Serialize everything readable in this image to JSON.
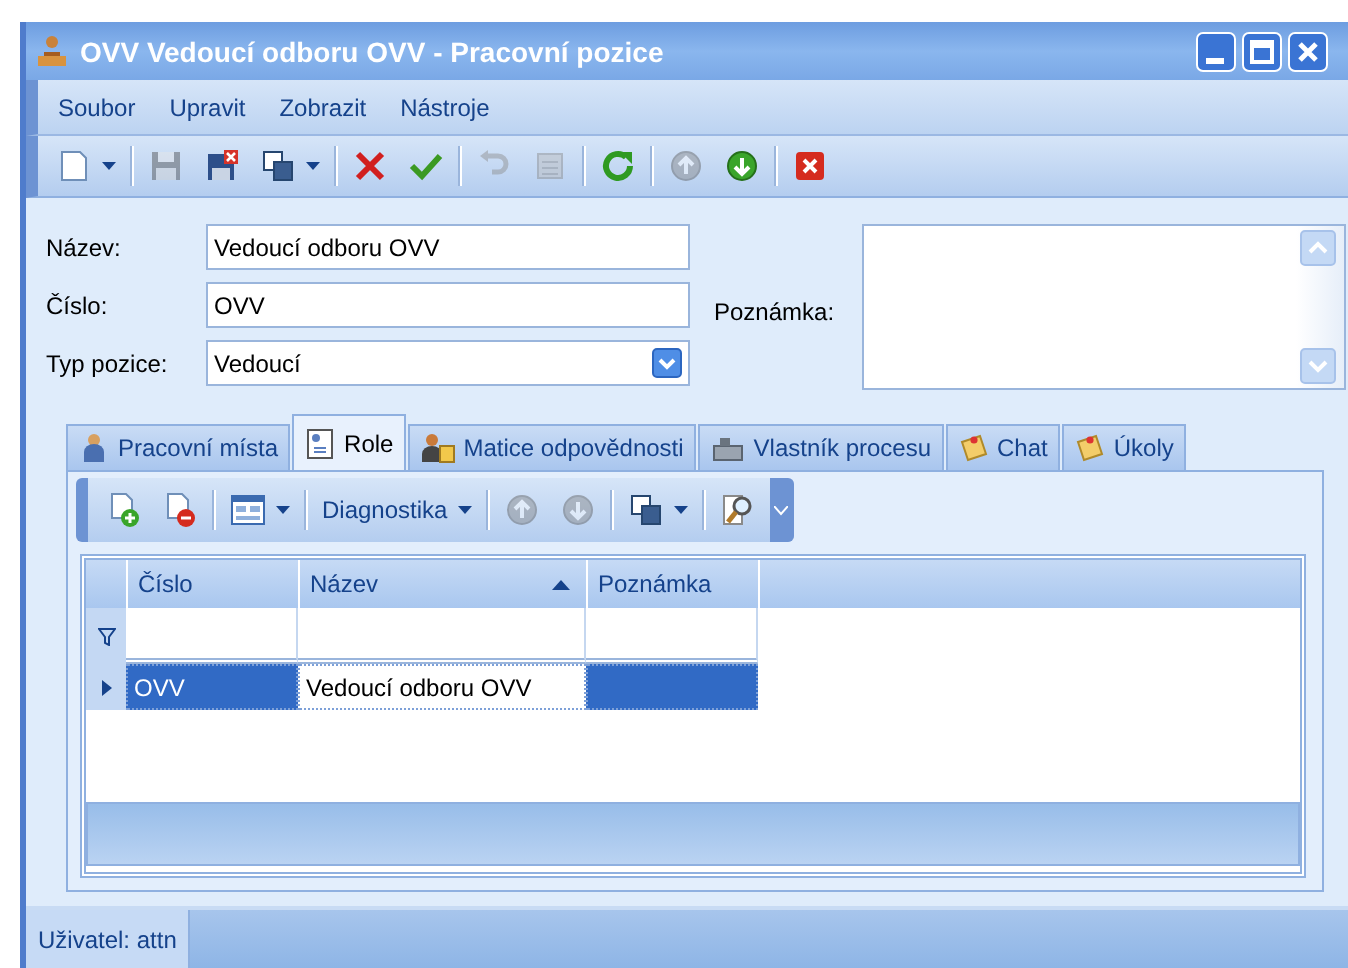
{
  "window": {
    "title": "OVV Vedoucí odboru OVV - Pracovní pozice"
  },
  "menu": [
    "Soubor",
    "Upravit",
    "Zobrazit",
    "Nástroje"
  ],
  "toolbar": [
    {
      "kind": "new",
      "dropdown": true,
      "disabled": false
    },
    {
      "kind": "separator"
    },
    {
      "kind": "save",
      "dropdown": false,
      "disabled": true
    },
    {
      "kind": "saveclose",
      "dropdown": false,
      "disabled": false
    },
    {
      "kind": "copy",
      "dropdown": true,
      "disabled": false
    },
    {
      "kind": "separator"
    },
    {
      "kind": "delete",
      "dropdown": false,
      "disabled": false
    },
    {
      "kind": "confirm",
      "dropdown": false,
      "disabled": false
    },
    {
      "kind": "separator"
    },
    {
      "kind": "undo",
      "dropdown": false,
      "disabled": true
    },
    {
      "kind": "list",
      "dropdown": false,
      "disabled": true
    },
    {
      "kind": "separator"
    },
    {
      "kind": "refresh",
      "dropdown": false,
      "disabled": false
    },
    {
      "kind": "separator"
    },
    {
      "kind": "up",
      "dropdown": false,
      "disabled": true
    },
    {
      "kind": "down",
      "dropdown": false,
      "disabled": false
    },
    {
      "kind": "separator"
    },
    {
      "kind": "close",
      "dropdown": false,
      "disabled": false
    }
  ],
  "form": {
    "fields": [
      {
        "kind": "text",
        "label": "Název:",
        "value": "Vedoucí odboru OVV"
      },
      {
        "kind": "text",
        "label": "Číslo:",
        "value": "OVV"
      },
      {
        "kind": "combo",
        "label": "Typ pozice:",
        "value": "Vedoucí"
      }
    ],
    "note": {
      "label": "Poznámka:"
    }
  },
  "tabs": [
    {
      "label": "Pracovní místa",
      "selected": false
    },
    {
      "label": "Role",
      "selected": true
    },
    {
      "label": "Matice odpovědnosti",
      "selected": false
    },
    {
      "label": "Vlastník procesu",
      "selected": false
    },
    {
      "label": "Chat",
      "selected": false
    },
    {
      "label": "Úkoly",
      "selected": false
    }
  ],
  "subtoolbar": [
    {
      "kind": "add",
      "dropdown": false,
      "disabled": false
    },
    {
      "kind": "remove",
      "dropdown": false,
      "disabled": false
    },
    {
      "kind": "separator"
    },
    {
      "kind": "layout",
      "dropdown": true,
      "disabled": false
    },
    {
      "kind": "separator"
    },
    {
      "kind": "text",
      "label": "Diagnostika",
      "dropdown": true,
      "disabled": false
    },
    {
      "kind": "separator"
    },
    {
      "kind": "up",
      "dropdown": false,
      "disabled": true
    },
    {
      "kind": "down",
      "dropdown": false,
      "disabled": true
    },
    {
      "kind": "separator"
    },
    {
      "kind": "export",
      "dropdown": true,
      "disabled": false
    },
    {
      "kind": "separator"
    },
    {
      "kind": "preview",
      "dropdown": false,
      "disabled": false
    }
  ],
  "grid": {
    "columns": [
      {
        "label": "Číslo",
        "sorted": false
      },
      {
        "label": "Název",
        "sorted": true
      },
      {
        "label": "Poznámka",
        "sorted": false
      }
    ],
    "rows": [
      {
        "cells": [
          "OVV",
          "Vedoucí odboru OVV"
        ],
        "selected": true
      }
    ]
  },
  "status_bar": {
    "user": "Uživatel: attn"
  }
}
